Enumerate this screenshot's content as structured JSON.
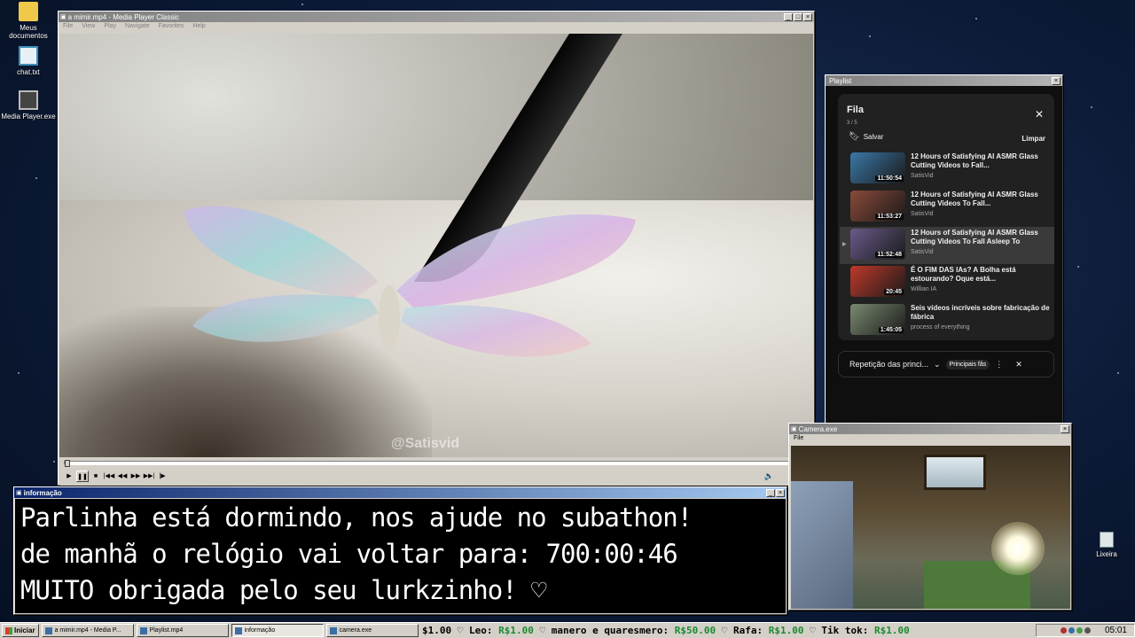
{
  "desktop": {
    "icons": [
      {
        "label": "Meus documentos",
        "icon": "folder-icon"
      },
      {
        "label": "chat.txt",
        "icon": "notepad-icon"
      },
      {
        "label": "Media Player.exe",
        "icon": "media-player-icon"
      }
    ],
    "recycle_bin": "Lixeira"
  },
  "player": {
    "title": "a mimir.mp4 - Media Player Classic",
    "menu": [
      "File",
      "View",
      "Play",
      "Navigate",
      "Favorites",
      "Help"
    ],
    "watermark": "@Satisvid",
    "progress": 0.001
  },
  "playlist_window": {
    "title": "Playlist",
    "queue_title": "Fila",
    "count": "3 / 5",
    "save_label": "Salvar",
    "clear_label": "Limpar",
    "items": [
      {
        "title": "12 Hours of Satisfying AI ASMR Glass Cutting Videos to Fall...",
        "channel": "SatisVid",
        "duration": "11:50:54",
        "thumb": "#3b78a8"
      },
      {
        "title": "12 Hours of Satisfying AI ASMR Glass Cutting Videos To Fall...",
        "channel": "SatisVid",
        "duration": "11:53:27",
        "thumb": "#8a4a3a"
      },
      {
        "title": "12 Hours of Satisfying AI ASMR Glass Cutting Videos To Fall Asleep To",
        "channel": "SatisVid",
        "duration": "11:52:48",
        "thumb": "#6a5a8a"
      },
      {
        "title": "É O FIM DAS IAs? A Bolha está estourando? Oque está...",
        "channel": "Willian IA",
        "duration": "20:45",
        "thumb": "#c0392b"
      },
      {
        "title": "Seis vídeos incríveis sobre fabricação de fábrica",
        "channel": "process of everything",
        "duration": "1:45:05",
        "thumb": "#7a8a70"
      }
    ],
    "loop_label": "Repetição das princi...",
    "pill_label": "Principais fãs"
  },
  "info_window": {
    "title": "informação",
    "lines": [
      "Parlinha está dormindo, nos ajude no subathon!",
      "de manhã o relógio vai voltar para:  700:00:46",
      "MUITO obrigada pelo seu lurkzinho! ♡"
    ]
  },
  "camera_window": {
    "title": "Camera.exe",
    "menu": "File"
  },
  "taskbar": {
    "start": "Iniciar",
    "tasks": [
      "a mimir.mp4 - Media P...",
      "Playlist.mp4",
      "informação",
      "camera.exe"
    ],
    "ticker": [
      {
        "text": "$1.00 ♡  Leo: ",
        "green": false,
        "lead": true
      },
      {
        "text": "R$1.00",
        "green": true
      },
      {
        "text": " ♡  manero e quaresmero: ",
        "green": false
      },
      {
        "text": "R$50.00",
        "green": true
      },
      {
        "text": " ♡  Rafa: ",
        "green": false
      },
      {
        "text": "R$1.00",
        "green": true
      },
      {
        "text": " ♡  Tik tok: ",
        "green": false
      },
      {
        "text": "R$1.00",
        "green": true
      }
    ],
    "clock": "05:01"
  }
}
